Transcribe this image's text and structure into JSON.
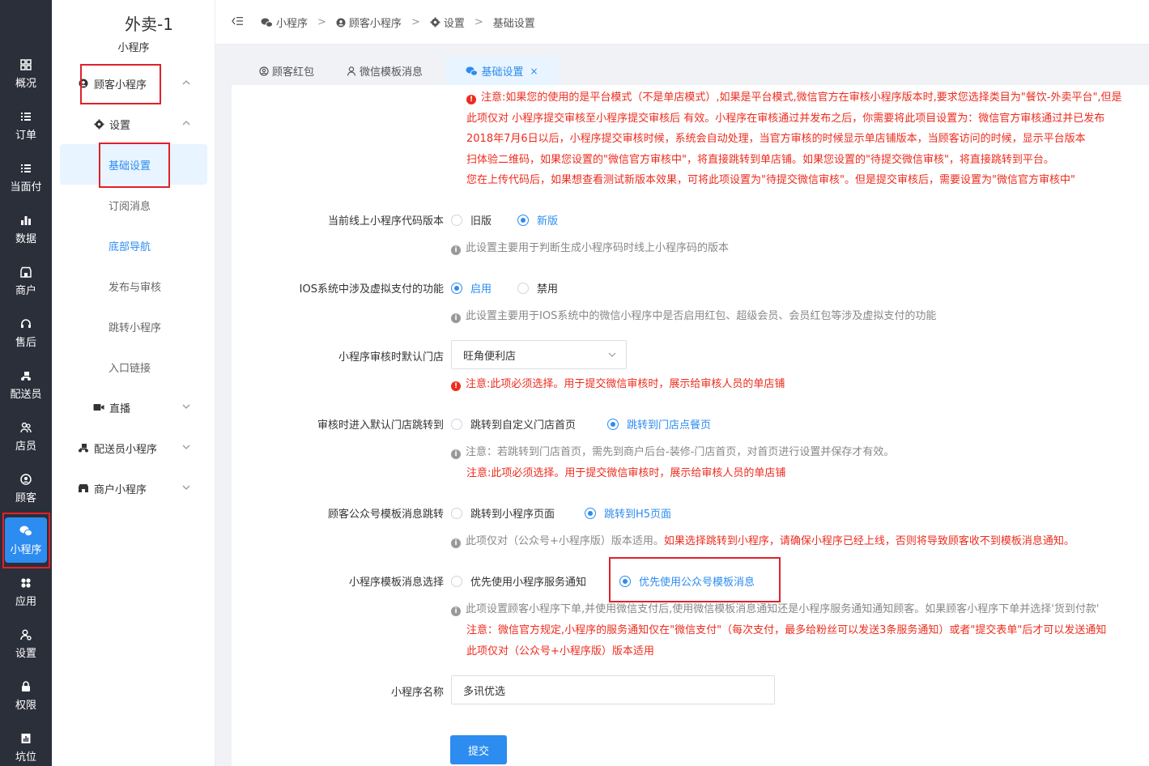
{
  "rail": {
    "items": [
      {
        "label": "概况",
        "icon": "dashboard-icon"
      },
      {
        "label": "订单",
        "icon": "list-icon"
      },
      {
        "label": "当面付",
        "icon": "list-icon"
      },
      {
        "label": "数据",
        "icon": "bar-chart-icon"
      },
      {
        "label": "商户",
        "icon": "store-icon"
      },
      {
        "label": "售后",
        "icon": "headset-icon"
      },
      {
        "label": "配送员",
        "icon": "scooter-icon"
      },
      {
        "label": "店员",
        "icon": "users-icon"
      },
      {
        "label": "顾客",
        "icon": "customer-icon"
      },
      {
        "label": "小程序",
        "icon": "wechat-icon"
      },
      {
        "label": "应用",
        "icon": "apps-icon"
      },
      {
        "label": "设置",
        "icon": "user-gear-icon"
      },
      {
        "label": "权限",
        "icon": "lock-icon"
      },
      {
        "label": "坑位",
        "icon": "doc-chart-icon"
      }
    ],
    "active_index": 9
  },
  "menu": {
    "title": "外卖-1",
    "subtitle": "小程序",
    "customer_app": "顾客小程序",
    "settings": "设置",
    "basic_settings": "基础设置",
    "subscribe_msg": "订阅消息",
    "bottom_nav": "底部导航",
    "publish_review": "发布与审核",
    "jump_app": "跳转小程序",
    "entry_link": "入口链接",
    "live": "直播",
    "courier_app": "配送员小程序",
    "merchant_app": "商户小程序"
  },
  "breadcrumb": {
    "items": [
      "小程序",
      "顾客小程序",
      "设置",
      "基础设置"
    ],
    "separator": ">"
  },
  "tabs": {
    "items": [
      {
        "label": "顾客红包"
      },
      {
        "label": "微信模板消息"
      },
      {
        "label": "基础设置",
        "active": true
      }
    ],
    "close_glyph": "×"
  },
  "notice": {
    "lines": [
      "注意:如果您的使用的是平台模式（不是单店模式）,如果是平台模式,微信官方在审核小程序版本时,要求您选择类目为\"餐饮-外卖平台\",但是",
      "此项仅对 小程序提交审核至小程序提交审核后 有效。小程序在审核通过并发布之后，你需要将此项目设置为：微信官方审核通过并已发布",
      "2018年7月6日以后，小程序提交审核时候，系统会自动处理，当官方审核的时候显示单店铺版本，当顾客访问的时候，显示平台版本",
      "扫体验二维码，如果您设置的\"微信官方审核中\"，将直接跳转到单店铺。如果您设置的\"待提交微信审核\"，将直接跳转到平台。",
      "您在上传代码后，如果想查看测试新版本效果，可将此项设置为\"待提交微信审核\"。但是提交审核后，需要设置为\"微信官方审核中\""
    ]
  },
  "form": {
    "code_version": {
      "label": "当前线上小程序代码版本",
      "options": [
        "旧版",
        "新版"
      ],
      "selected": 1,
      "hint": "此设置主要用于判断生成小程序码时线上小程序码的版本"
    },
    "ios_pay": {
      "label": "IOS系统中涉及虚拟支付的功能",
      "options": [
        "启用",
        "禁用"
      ],
      "selected": 0,
      "hint": "此设置主要用于IOS系统中的微信小程序中是否启用红包、超级会员、会员红包等涉及虚拟支付的功能"
    },
    "review_store": {
      "label": "小程序审核时默认门店",
      "value": "旺角便利店",
      "note": "注意:此项必须选择。用于提交微信审核时，展示给审核人员的单店铺"
    },
    "review_jump": {
      "label": "审核时进入默认门店跳转到",
      "options": [
        "跳转到自定义门店首页",
        "跳转到门店点餐页"
      ],
      "selected": 1,
      "hint": "注意：若跳转到门店首页，需先到商户后台-装修-门店首页，对首页进行设置并保存才有效。",
      "note": "注意:此项必须选择。用于提交微信审核时，展示给审核人员的单店铺"
    },
    "template_jump": {
      "label": "顾客公众号模板消息跳转",
      "options": [
        "跳转到小程序页面",
        "跳转到H5页面"
      ],
      "selected": 1,
      "hint": "此项仅对（公众号+小程序版）版本适用。",
      "hint_red": "如果选择跳转到小程序，请确保小程序已经上线，否则将导致顾客收不到模板消息通知。"
    },
    "template_choice": {
      "label": "小程序模板消息选择",
      "options": [
        "优先使用小程序服务通知",
        "优先使用公众号模板消息"
      ],
      "selected": 1,
      "hint": "此项设置顾客小程序下单,并使用微信支付后,使用微信模板消息通知还是小程序服务通知通知顾客。如果顾客小程序下单并选择'货到付款'",
      "note1": "注意：微信官方规定,小程序的服务通知仅在\"微信支付\"（每次支付，最多给粉丝可以发送3条服务通知）或者\"提交表单\"后才可以发送通知",
      "note2": "此项仅对（公众号+小程序版）版本适用"
    },
    "app_name": {
      "label": "小程序名称",
      "value": "多讯优选"
    },
    "submit_label": "提交"
  },
  "colors": {
    "accent": "#2d8cf0",
    "warning": "#ed2c1e",
    "rail_bg": "#2b2f3a",
    "highlight_box": "#e0212b"
  }
}
